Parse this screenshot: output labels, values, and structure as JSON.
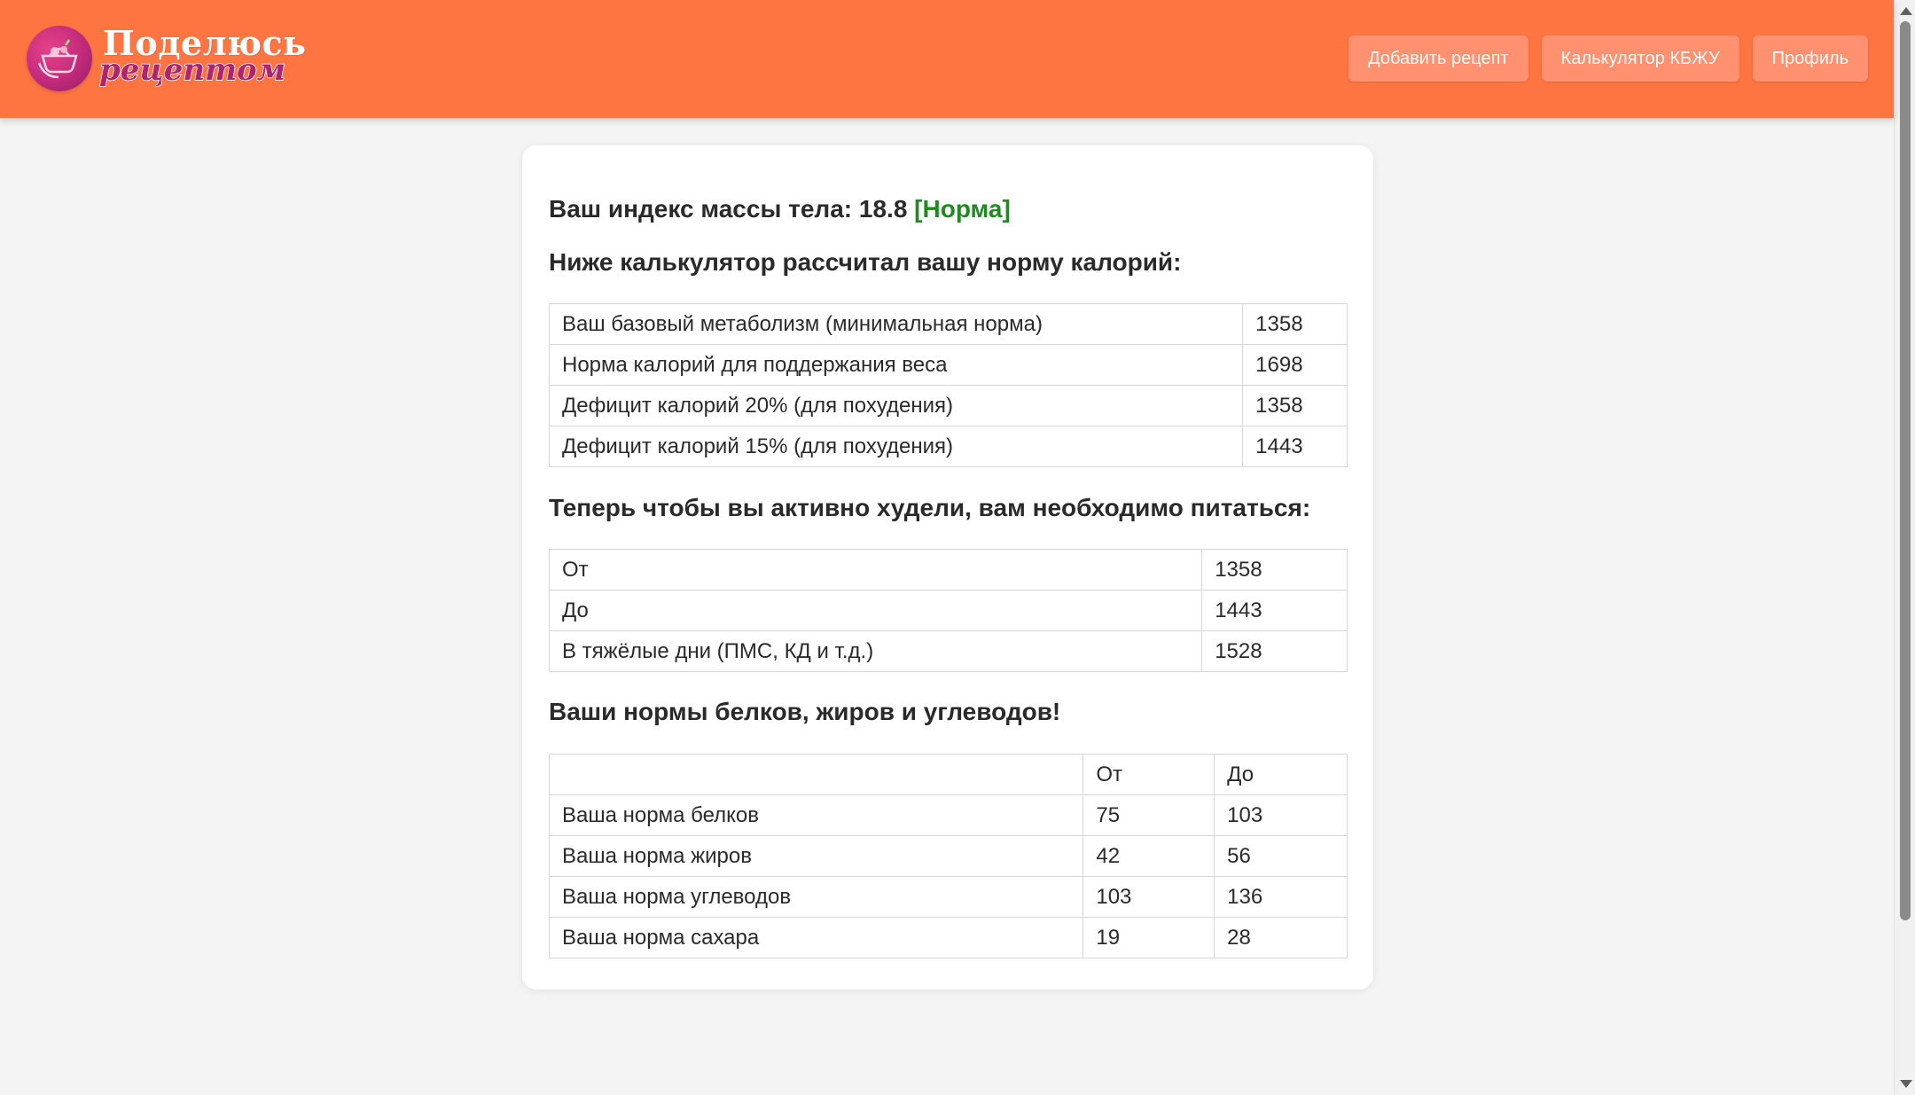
{
  "header": {
    "logo_title": "Поделюсь",
    "logo_subtitle": "рецептом",
    "nav": [
      {
        "label": "Добавить рецепт"
      },
      {
        "label": "Калькулятор КБЖУ"
      },
      {
        "label": "Профиль"
      }
    ]
  },
  "bmi": {
    "label": "Ваш индекс массы тела:",
    "value": "18.8",
    "status": "[Норма]",
    "status_color": "#1f8a1f"
  },
  "calories": {
    "heading": "Ниже калькулятор рассчитал вашу норму калорий:",
    "rows": [
      {
        "label": "Ваш базовый метаболизм (минимальная норма)",
        "value": "1358"
      },
      {
        "label": "Норма калорий для поддержания веса",
        "value": "1698"
      },
      {
        "label": "Дефицит калорий 20% (для похудения)",
        "value": "1358"
      },
      {
        "label": "Дефицит калорий 15% (для похудения)",
        "value": "1443"
      }
    ]
  },
  "weight_loss": {
    "heading": "Теперь чтобы вы активно худели, вам необходимо питаться:",
    "rows": [
      {
        "label": "От",
        "value": "1358"
      },
      {
        "label": "До",
        "value": "1443"
      },
      {
        "label": "В тяжёлые дни (ПМС, КД и т.д.)",
        "value": "1528"
      }
    ]
  },
  "macros": {
    "heading": "Ваши нормы белков, жиров и углеводов!",
    "columns": [
      "",
      "От",
      "До"
    ],
    "rows": [
      {
        "label": "Ваша норма белков",
        "from": "75",
        "to": "103"
      },
      {
        "label": "Ваша норма жиров",
        "from": "42",
        "to": "56"
      },
      {
        "label": "Ваша норма углеводов",
        "from": "103",
        "to": "136"
      },
      {
        "label": "Ваша норма сахара",
        "from": "19",
        "to": "28"
      }
    ]
  },
  "theme": {
    "header_bg": "#ff7542",
    "button_bg": "#ff9070",
    "page_bg": "#f4f4f4"
  }
}
